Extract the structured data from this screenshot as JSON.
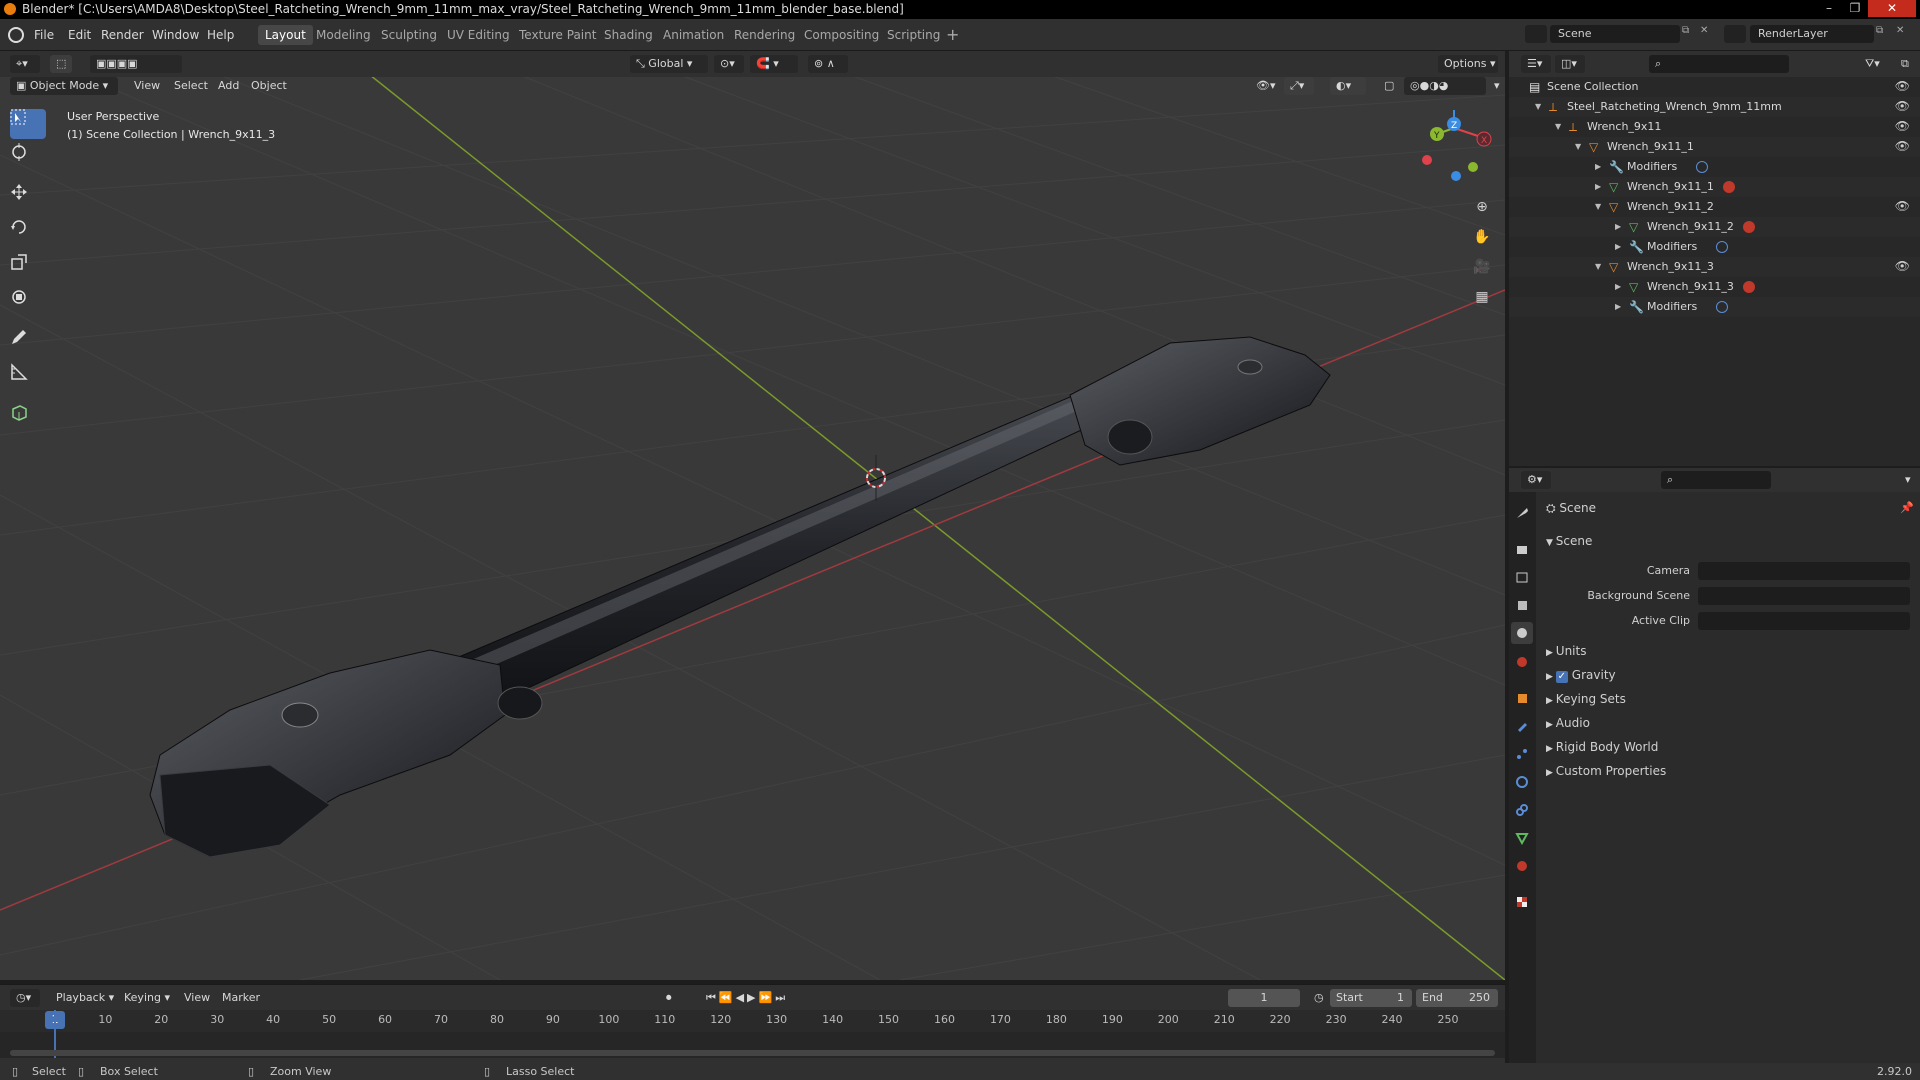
{
  "titlebar": {
    "title": "Blender* [C:\\Users\\AMDA8\\Desktop\\Steel_Ratcheting_Wrench_9mm_11mm_max_vray/Steel_Ratcheting_Wrench_9mm_11mm_blender_base.blend]"
  },
  "menu": [
    "File",
    "Edit",
    "Render",
    "Window",
    "Help"
  ],
  "workspaces": [
    "Layout",
    "Modeling",
    "Sculpting",
    "UV Editing",
    "Texture Paint",
    "Shading",
    "Animation",
    "Rendering",
    "Compositing",
    "Scripting"
  ],
  "active_workspace": "Layout",
  "scene_selector": "Scene",
  "view_layer": "RenderLayer",
  "viewport": {
    "mode": "Object Mode",
    "menus": [
      "View",
      "Select",
      "Add",
      "Object"
    ],
    "transform_orientation": "Global",
    "options_label": "Options",
    "view_name": "User Perspective",
    "collection_info": "(1) Scene Collection | Wrench_9x11_3",
    "gizmo_axes": [
      "X",
      "Y",
      "Z"
    ]
  },
  "outliner": {
    "rows": [
      {
        "label": "Scene Collection",
        "depth": 0,
        "type": "collection"
      },
      {
        "label": "Steel_Ratcheting_Wrench_9mm_11mm",
        "depth": 1,
        "type": "empty"
      },
      {
        "label": "Wrench_9x11",
        "depth": 2,
        "type": "empty"
      },
      {
        "label": "Wrench_9x11_1",
        "depth": 3,
        "type": "mesh-object"
      },
      {
        "label": "Modifiers",
        "depth": 4,
        "type": "modifier"
      },
      {
        "label": "Wrench_9x11_1",
        "depth": 4,
        "type": "mesh-data"
      },
      {
        "label": "Wrench_9x11_2",
        "depth": 4,
        "type": "mesh-object"
      },
      {
        "label": "Wrench_9x11_2",
        "depth": 5,
        "type": "mesh-data"
      },
      {
        "label": "Modifiers",
        "depth": 5,
        "type": "modifier"
      },
      {
        "label": "Wrench_9x11_3",
        "depth": 4,
        "type": "mesh-object"
      },
      {
        "label": "Wrench_9x11_3",
        "depth": 5,
        "type": "mesh-data"
      },
      {
        "label": "Modifiers",
        "depth": 5,
        "type": "modifier"
      }
    ]
  },
  "properties": {
    "context": "Scene",
    "panel_title": "Scene",
    "fields": [
      {
        "label": "Camera",
        "value": ""
      },
      {
        "label": "Background Scene",
        "value": ""
      },
      {
        "label": "Active Clip",
        "value": ""
      }
    ],
    "sections": [
      "Units",
      "Gravity",
      "Keying Sets",
      "Audio",
      "Rigid Body World",
      "Custom Properties"
    ],
    "gravity_checked": true
  },
  "timeline": {
    "menus": [
      "Playback",
      "Keying",
      "View",
      "Marker"
    ],
    "current_frame": "1",
    "start_label": "Start",
    "start": "1",
    "end_label": "End",
    "end": "250",
    "ticks": [
      "1",
      "10",
      "20",
      "30",
      "40",
      "50",
      "60",
      "70",
      "80",
      "90",
      "100",
      "110",
      "120",
      "130",
      "140",
      "150",
      "160",
      "170",
      "180",
      "190",
      "200",
      "210",
      "220",
      "230",
      "240",
      "250"
    ]
  },
  "statusbar": {
    "items": [
      "Select",
      "Box Select",
      "Zoom View",
      "Lasso Select"
    ],
    "version": "2.92.0"
  },
  "colors": {
    "accent": "#4772b3",
    "x_axis": "#e0424b",
    "y_axis": "#8bb82f",
    "z_axis": "#3b8ce3"
  }
}
